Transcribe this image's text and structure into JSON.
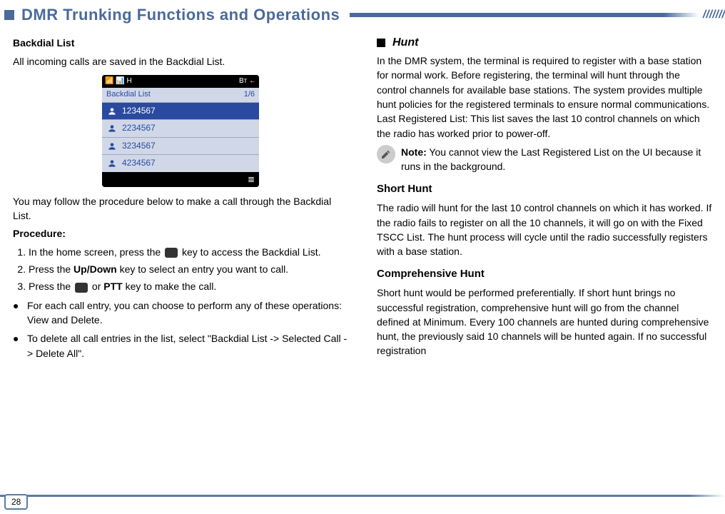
{
  "header": {
    "title": "DMR Trunking Functions and Operations",
    "slashes": "///////"
  },
  "left": {
    "backdial_head": "Backdial List",
    "backdial_intro": "All incoming calls are saved in the Backdial List.",
    "phone": {
      "status_left": "📶 📊 H",
      "status_right": "Bт      ←",
      "title": "Backdial List",
      "count": "1/6",
      "entries": [
        "1234567",
        "2234567",
        "3234567",
        "4234567"
      ],
      "menu_icon": "≣"
    },
    "follow": "You may follow the procedure below to make a call through the Backdial List.",
    "proc_label": "Procedure:",
    "step1a": "In the home screen, press the ",
    "step1b": " key to access the Backdial List.",
    "step2a": "Press the ",
    "step2b": "Up/Down",
    "step2c": " key to select an entry you want to call.",
    "step3a": "Press the ",
    "step3b": " or ",
    "step3c": "PTT",
    "step3d": " key to make the call.",
    "bullet1": "For each call entry, you can choose to perform any of these operations: View and Delete.",
    "bullet2": "To delete all call entries in the list, select \"Backdial List -> Selected Call -> Delete All\"."
  },
  "right": {
    "hunt_title": "Hunt",
    "hunt_body": "In the DMR system, the terminal is required to register with a base station for normal work. Before registering, the terminal will hunt through the control channels for available base stations. The system provides multiple hunt policies for the registered terminals to ensure normal communications.\nLast Registered List: This list saves the last 10 control channels on which the radio has worked prior to power-off.",
    "note_label": "Note:",
    "note_body": " You cannot view the Last Registered List on the UI because it runs in the background.",
    "short_head": "Short Hunt",
    "short_body": "The radio will hunt for the last 10 control channels on which it has worked. If the radio fails to register on all the 10 channels, it will go on with the Fixed TSCC List. The hunt process will cycle until the radio successfully registers with a base station.",
    "comp_head": "Comprehensive Hunt",
    "comp_body": "Short hunt would be performed preferentially. If short hunt brings no successful registration, comprehensive hunt will go from the channel defined at Minimum. Every 100 channels are hunted during comprehensive hunt, the previously said 10 channels will be hunted again. If no successful registration"
  },
  "page_number": "28"
}
